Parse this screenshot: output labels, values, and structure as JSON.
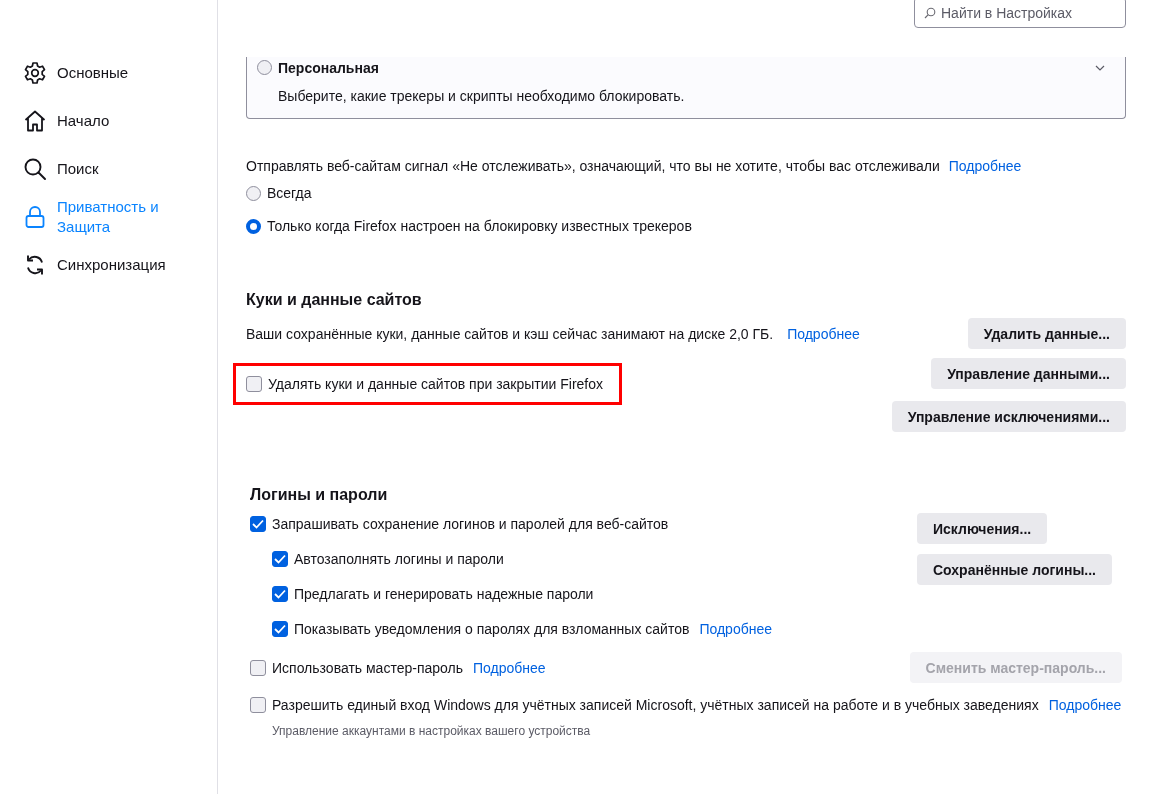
{
  "sidebar": {
    "items": [
      {
        "kind": "gear",
        "label": "Основные",
        "selected": false
      },
      {
        "kind": "home",
        "label": "Начало",
        "selected": false
      },
      {
        "kind": "search",
        "label": "Поиск",
        "selected": false
      },
      {
        "kind": "lock",
        "label": "Приватность и Защита",
        "selected": true
      },
      {
        "kind": "sync",
        "label": "Синхронизация",
        "selected": false
      }
    ]
  },
  "search": {
    "placeholder": "Найти в Настройках"
  },
  "tracking_protection": {
    "option": {
      "label": "Персональная",
      "selected": false,
      "expanded": false,
      "description": "Выберите, какие трекеры и скрипты необходимо блокировать."
    }
  },
  "do_not_track": {
    "label": "Отправлять веб-сайтам сигнал «Не отслеживать», означающий, что вы не хотите, чтобы вас отслеживали",
    "link": "Подробнее",
    "options": [
      {
        "label": "Всегда",
        "selected": false
      },
      {
        "label": "Только когда Firefox настроен на блокировку известных трекеров",
        "selected": true
      }
    ]
  },
  "cookies": {
    "heading": "Куки и данные сайтов",
    "usage_text": "Ваши сохранённые куки, данные сайтов и кэш сейчас занимают на диске 2,0 ГБ.",
    "link": "Подробнее",
    "delete_on_close": {
      "label": "Удалять куки и данные сайтов при закрытии Firefox",
      "checked": false,
      "highlighted": true
    },
    "buttons": [
      {
        "label": "Удалить данные...",
        "disabled": false
      },
      {
        "label": "Управление данными...",
        "disabled": false
      },
      {
        "label": "Управление исключениями...",
        "disabled": false
      }
    ]
  },
  "logins": {
    "heading": "Логины и пароли",
    "ask_to_save": {
      "label": "Запрашивать сохранение логинов и паролей для веб-сайтов",
      "checked": true,
      "children": [
        {
          "label": "Автозаполнять логины и пароли",
          "checked": true
        },
        {
          "label": "Предлагать и генерировать надежные пароли",
          "checked": true
        },
        {
          "label": "Показывать уведомления о паролях для взломанных сайтов",
          "checked": true,
          "link": "Подробнее"
        }
      ]
    },
    "buttons": [
      {
        "label": "Исключения...",
        "disabled": false
      },
      {
        "label": "Сохранённые логины...",
        "disabled": false
      }
    ],
    "master_password": {
      "label": "Использовать мастер-пароль",
      "checked": false,
      "link": "Подробнее",
      "button": {
        "label": "Сменить мастер-пароль...",
        "disabled": true
      }
    },
    "windows_sso": {
      "label": "Разрешить единый вход Windows для учётных записей Microsoft, учётных записей на работе и в учебных заведениях",
      "checked": false,
      "link": "Подробнее",
      "note": "Управление аккаунтами в настройках вашего устройства"
    }
  }
}
